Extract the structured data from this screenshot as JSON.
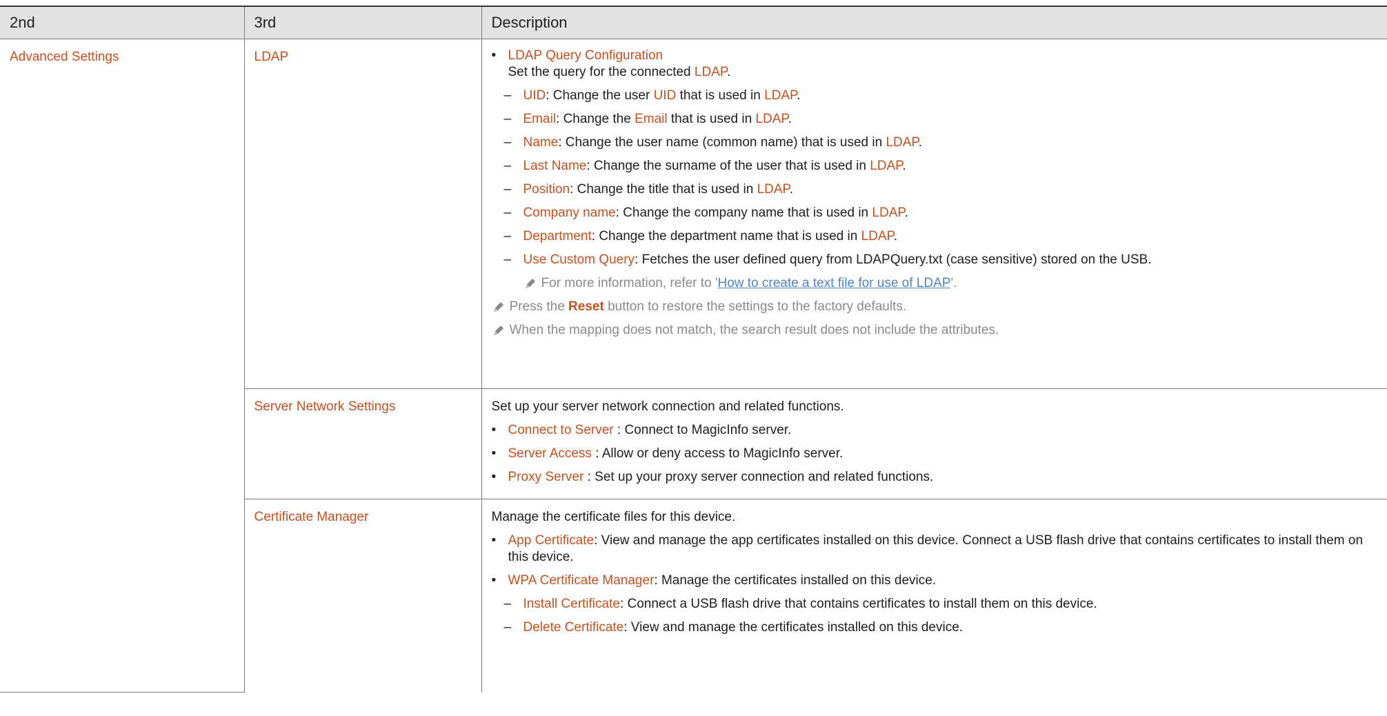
{
  "headers": [
    "2nd",
    "3rd",
    "Description"
  ],
  "col2": "Advanced Settings",
  "ldap": {
    "name": "LDAP",
    "query_title": "LDAP Query Configuration",
    "query_desc_pre": "Set the query for the connected ",
    "query_desc_hl": "LDAP",
    "query_desc_post": ".",
    "items": {
      "uid": {
        "key": "UID",
        "a": ": Change the user ",
        "b": "UID",
        "c": " that is used in ",
        "d": "LDAP",
        "e": "."
      },
      "email": {
        "key": "Email",
        "a": ": Change the ",
        "b": "Email",
        "c": " that is used in ",
        "d": "LDAP",
        "e": "."
      },
      "name": {
        "key": "Name",
        "a": ": Change the user name (common name) that is used in ",
        "d": "LDAP",
        "e": "."
      },
      "last": {
        "key": "Last Name",
        "a": ": Change the surname of the user that is used in ",
        "d": "LDAP",
        "e": "."
      },
      "pos": {
        "key": "Position",
        "a": ": Change the title that is used in ",
        "d": "LDAP",
        "e": "."
      },
      "comp": {
        "key": "Company name",
        "a": ": Change the company name that is used in ",
        "d": "LDAP",
        "e": "."
      },
      "dept": {
        "key": "Department",
        "a": ": Change the department name that is used in ",
        "d": "LDAP",
        "e": "."
      },
      "custom": {
        "key": "Use Custom Query",
        "a": ": Fetches the user defined query from LDAPQuery.txt (case sensitive) stored on the USB."
      }
    },
    "info_pre": "For more information, refer to '",
    "info_link": "How to create a text file for use of LDAP",
    "info_post": "'.",
    "note1_pre": "Press the ",
    "note1_bold": "Reset",
    "note1_post": " button to restore the settings to the factory defaults.",
    "note2": "When the mapping does not match, the search result does not include the attributes."
  },
  "server": {
    "name": "Server Network Settings",
    "intro": "Set up your server network connection and related functions.",
    "items": [
      {
        "key": "Connect to Server",
        "text": " : Connect to MagicInfo server."
      },
      {
        "key": "Server Access",
        "text": " : Allow or deny access to MagicInfo server."
      },
      {
        "key": "Proxy Server",
        "text": " : Set up your proxy server connection and related functions."
      }
    ]
  },
  "cert": {
    "name": "Certificate Manager",
    "intro": "Manage the certificate files for this device.",
    "app": {
      "key": "App Certificate",
      "text": ": View and manage the app certificates installed on this device. Connect a USB flash drive that contains certificates to install them on this device."
    },
    "wpa": {
      "key": "WPA Certificate Manager",
      "text": ": Manage the certificates installed on this device."
    },
    "install": {
      "key": "Install Certificate",
      "text": ": Connect a USB flash drive that contains certificates to install them on this device."
    },
    "delete": {
      "key": "Delete Certificate",
      "text": ": View and manage the certificates installed on this device."
    }
  },
  "icons": {
    "note": "pencil-note-icon"
  },
  "colors": {
    "highlight": "#c9501c",
    "header_bg": "#e2e2e2",
    "note_text": "#8a8a8a",
    "link": "#4f86c6"
  }
}
